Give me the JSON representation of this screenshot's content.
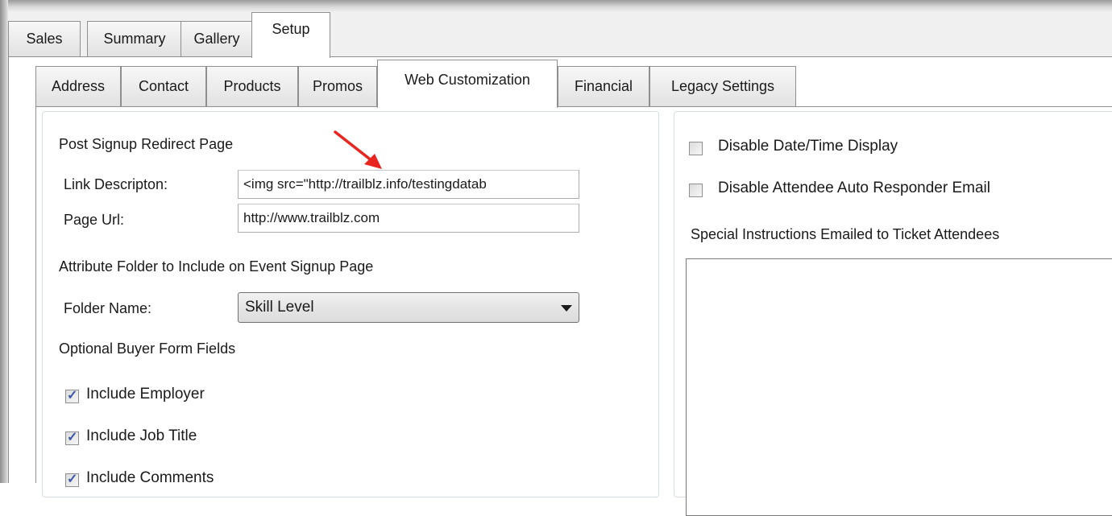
{
  "outer_tabs": [
    "Sales",
    "Summary",
    "Gallery",
    "Setup"
  ],
  "inner_tabs": [
    "Address",
    "Contact",
    "Products",
    "Promos",
    "Web Customization",
    "Financial",
    "Legacy Settings"
  ],
  "left_group": {
    "post_signup_heading": "Post Signup Redirect Page",
    "link_description_label": "Link Descripton:",
    "link_description_value": "<img src=\"http://trailblz.info/testingdatab",
    "page_url_label": "Page Url:",
    "page_url_value": "http://www.trailblz.com",
    "attribute_folder_heading": "Attribute Folder to Include on Event Signup Page",
    "folder_name_label": "Folder Name:",
    "folder_name_value": "Skill Level",
    "optional_fields_heading": "Optional Buyer Form Fields",
    "checkboxes": [
      {
        "label": "Include Employer",
        "checked": true
      },
      {
        "label": "Include Job Title",
        "checked": true
      },
      {
        "label": "Include Comments",
        "checked": true
      }
    ]
  },
  "right_group": {
    "checkboxes": [
      {
        "label": "Disable Date/Time Display",
        "checked": false
      },
      {
        "label": "Disable Attendee Auto Responder Email",
        "checked": false
      }
    ],
    "special_instructions_label": "Special Instructions Emailed to Ticket Attendees",
    "special_instructions_value": ""
  },
  "annotation_arrow_color": "#e8251f"
}
